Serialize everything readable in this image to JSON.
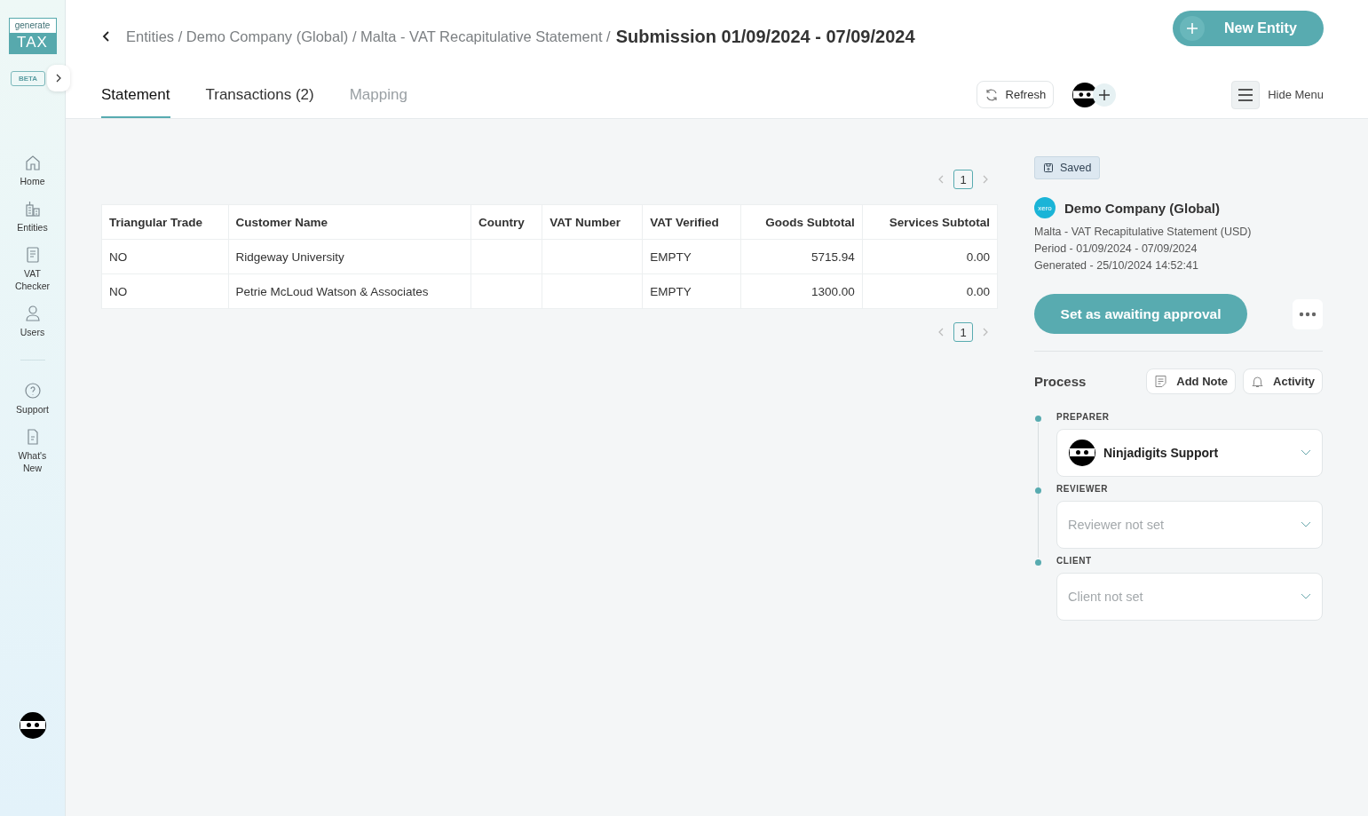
{
  "logo": {
    "top": "generate",
    "bottom": "TAX",
    "badge": "BETA"
  },
  "sidebar": {
    "items": [
      {
        "label": "Home",
        "kind": "home"
      },
      {
        "label": "Entities",
        "kind": "buildings"
      },
      {
        "label": "VAT Checker",
        "kind": "document"
      },
      {
        "label": "Users",
        "kind": "user"
      }
    ],
    "support_items": [
      {
        "label": "Support",
        "kind": "help"
      },
      {
        "label": "What's New",
        "kind": "file"
      }
    ]
  },
  "breadcrumb": {
    "path": "Entities / Demo Company (Global) / Malta - VAT Recapitulative Statement /",
    "current": "Submission 01/09/2024 - 07/09/2024"
  },
  "new_entity_button": "New Entity",
  "tabs": [
    {
      "label": "Statement",
      "selected": true,
      "disabled": false
    },
    {
      "label": "Transactions (2)",
      "selected": false,
      "disabled": false
    },
    {
      "label": "Mapping",
      "selected": false,
      "disabled": true
    }
  ],
  "refresh_button": "Refresh",
  "hide_menu_button": "Hide Menu",
  "pagination_top": {
    "pages": [
      {
        "label": "1",
        "selected": true
      }
    ]
  },
  "table": {
    "columns": [
      "Triangular Trade",
      "Customer Name",
      "Country",
      "VAT Number",
      "VAT Verified",
      "Goods Subtotal",
      "Services Subtotal"
    ],
    "rows": [
      [
        "NO",
        "Ridgeway University",
        "",
        "",
        "EMPTY",
        "5715.94",
        "0.00"
      ],
      [
        "NO",
        "Petrie McLoud Watson & Associates",
        "",
        "",
        "EMPTY",
        "1300.00",
        "0.00"
      ]
    ]
  },
  "pagination_bottom": {
    "pages": [
      {
        "label": "1",
        "selected": true
      }
    ]
  },
  "panel": {
    "status": "Saved",
    "company": "Demo Company (Global)",
    "logo_text": "xero",
    "details": [
      "Malta - VAT Recapitulative Statement (USD)",
      "Period - 01/09/2024 - 07/09/2024",
      "Generated - 25/10/2024 14:52:41"
    ],
    "primary_action": "Set as awaiting approval",
    "process_title": "Process",
    "add_note_button": "Add Note",
    "activity_button": "Activity",
    "steps": [
      {
        "label": "PREPARER",
        "value": "Ninjadigits Support"
      },
      {
        "label": "REVIEWER",
        "placeholder": "Reviewer not set"
      },
      {
        "label": "CLIENT",
        "placeholder": "Client not set"
      }
    ]
  }
}
